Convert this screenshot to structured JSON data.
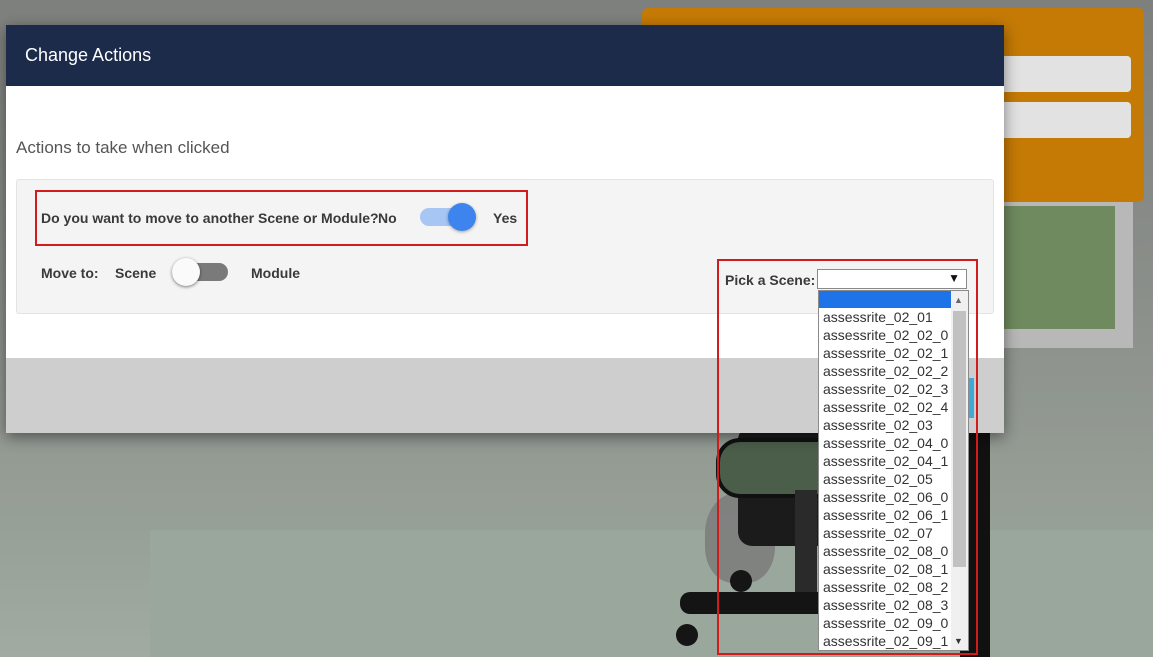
{
  "modal": {
    "title": "Change Actions",
    "section_title": "Actions to take when clicked"
  },
  "move_question": {
    "label": "Do you want to move to another Scene or Module?",
    "no_label": "No",
    "yes_label": "Yes",
    "value": "Yes"
  },
  "move_to": {
    "label": "Move to:",
    "scene_label": "Scene",
    "module_label": "Module",
    "value": "Scene"
  },
  "scene_picker": {
    "label": "Pick a Scene:",
    "selected_value": "",
    "options": [
      "",
      "assessrite_02_01",
      "assessrite_02_02_0",
      "assessrite_02_02_1",
      "assessrite_02_02_2",
      "assessrite_02_02_3",
      "assessrite_02_02_4",
      "assessrite_02_03",
      "assessrite_02_04_0",
      "assessrite_02_04_1",
      "assessrite_02_05",
      "assessrite_02_06_0",
      "assessrite_02_06_1",
      "assessrite_02_07",
      "assessrite_02_08_0",
      "assessrite_02_08_1",
      "assessrite_02_08_2",
      "assessrite_02_08_3",
      "assessrite_02_09_0",
      "assessrite_02_09_1"
    ]
  },
  "colors": {
    "header_bg": "#1d2b4a",
    "toggle_on": "#3d84ee",
    "highlight": "#d21c1c",
    "selected_option": "#1e73e8"
  },
  "icons": {
    "dropdown": "caret-down-icon",
    "scroll_up": "arrow-up-icon",
    "scroll_down": "arrow-down-icon"
  }
}
